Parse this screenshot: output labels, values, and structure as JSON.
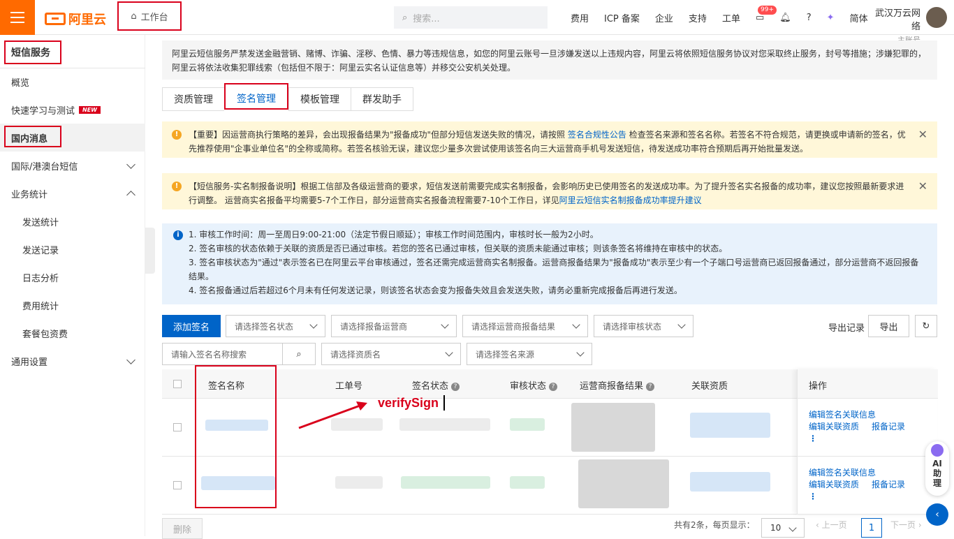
{
  "topbar": {
    "brand": "阿里云",
    "workbench": "工作台",
    "search_placeholder": "搜索...",
    "nav": [
      "费用",
      "ICP 备案",
      "企业",
      "支持",
      "工单"
    ],
    "notif_badge": "99+",
    "lang": "简体",
    "account_name": "武汉万云网络",
    "account_sub": "主账号"
  },
  "sidebar": {
    "title": "短信服务",
    "items": [
      {
        "label": "概览"
      },
      {
        "label": "快速学习与测试",
        "badge": "NEW"
      },
      {
        "label": "国内消息"
      },
      {
        "label": "国际/港澳台短信"
      },
      {
        "label": "业务统计"
      },
      {
        "label": "发送统计"
      },
      {
        "label": "发送记录"
      },
      {
        "label": "日志分析"
      },
      {
        "label": "费用统计"
      },
      {
        "label": "套餐包资费"
      },
      {
        "label": "通用设置"
      }
    ]
  },
  "notice": "阿里云短信服务严禁发送金融营销、赌博、诈骗、淫秽、色情、暴力等违规信息，如您的阿里云账号一旦涉嫌发送以上违规内容，阿里云将依照短信服务协议对您采取终止服务，封号等措施；涉嫌犯罪的，阿里云将依法收集犯罪线索（包括但不限于：阿里云实名认证信息等）并移交公安机关处理。",
  "tabs": [
    "资质管理",
    "签名管理",
    "模板管理",
    "群发助手"
  ],
  "alert1": {
    "pre": "【重要】因运营商执行策略的差异，会出现报备结果为\"报备成功\"但部分短信发送失败的情况，请按照 ",
    "link": "签名合规性公告",
    "post": " 检查签名来源和签名名称。若签名不符合规范，请更换或申请新的签名，优先推荐使用\"企事业单位名\"的全称或简称。若签名核验无误，建议您少量多次尝试使用该签名向三大运营商手机号发送短信，待发送成功率符合预期后再开始批量发送。"
  },
  "alert2": {
    "pre": "【短信服务-实名制报备说明】根据工信部及各级运营商的要求，短信发送前需要完成实名制报备，会影响历史已使用签名的发送成功率。为了提升签名实名报备的成功率，建议您按照最新要求进行调整。 运营商实名报备平均需要5-7个工作日，部分运营商实名报备流程需要7-10个工作日，详见",
    "link": "阿里云短信实名制报备成功率提升建议"
  },
  "info": [
    "1. 审核工作时间：周一至周日9:00-21:00（法定节假日顺延）；审核工作时间范围内，审核时长一般为2小时。",
    "2. 签名审核的状态依赖于关联的资质是否已通过审核。若您的签名已通过审核，但关联的资质未能通过审核；则该条签名将维持在审核中的状态。",
    "3. 签名审核状态为\"通过\"表示签名已在阿里云平台审核通过，签名还需完成运营商实名制报备。运营商报备结果为\"报备成功\"表示至少有一个子端口号运营商已返回报备通过，部分运营商不返回报备结果。",
    "4. 签名报备通过后若超过6个月未有任何发送记录，则该签名状态会变为报备失效且会发送失败，请务必重新完成报备后再进行发送。"
  ],
  "toolbar": {
    "add": "添加签名",
    "filters": [
      "请选择签名状态",
      "请选择报备运营商",
      "请选择运营商报备结果",
      "请选择审核状态"
    ],
    "export_record": "导出记录",
    "export": "导出",
    "search_placeholder": "请输入签名名称搜索",
    "filters2": [
      "请选择资质名",
      "请选择签名来源"
    ]
  },
  "table": {
    "headers": [
      "签名名称",
      "工单号",
      "签名状态",
      "审核状态",
      "运营商报备结果",
      "关联资质",
      "操作"
    ],
    "ops": {
      "edit_info": "编辑签名关联信息",
      "edit_qual": "编辑关联资质",
      "record": "报备记录",
      "more": "⋮"
    }
  },
  "annotation": {
    "text": "verifySign"
  },
  "footer": {
    "delete": "删除",
    "summary": "共有2条，每页显示：",
    "page_size": "10",
    "prev": "上一页",
    "page": "1",
    "next": "下一页"
  },
  "ai_assistant": "AI助理"
}
